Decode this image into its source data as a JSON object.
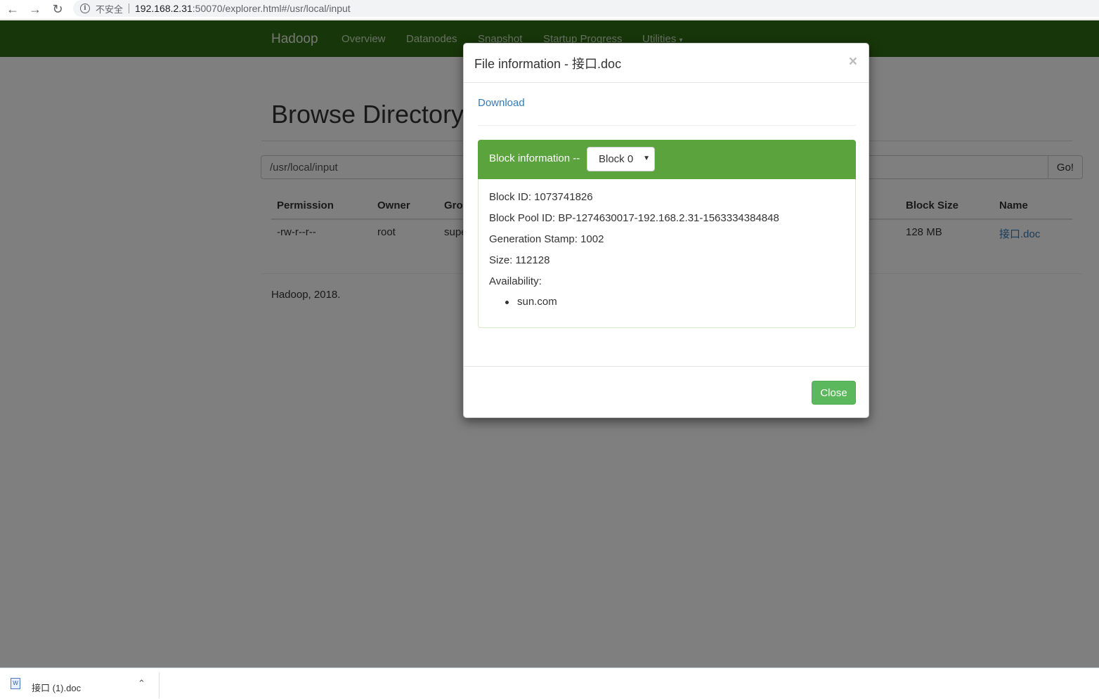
{
  "browser": {
    "insecure_label": "不安全",
    "url_host": "192.168.2.31",
    "url_rest": ":50070/explorer.html#/usr/local/input"
  },
  "navbar": {
    "brand": "Hadoop",
    "links": [
      "Overview",
      "Datanodes",
      "Snapshot",
      "Startup Progress",
      "Utilities"
    ]
  },
  "page": {
    "heading": "Browse Directory",
    "path_value": "/usr/local/input",
    "go_label": "Go!",
    "columns": [
      "Permission",
      "Owner",
      "Gro",
      "Block Size",
      "Name"
    ],
    "row": {
      "permission": "-rw-r--r--",
      "owner": "root",
      "group": "supe",
      "block_size": "128 MB",
      "name": "接口.doc"
    },
    "footer": "Hadoop, 2018."
  },
  "modal": {
    "title": "File information - 接口.doc",
    "close_x": "×",
    "download": "Download",
    "block_info_label": "Block information --",
    "block_selected": "Block 0",
    "block_id": "Block ID: 1073741826",
    "block_pool_id": "Block Pool ID: BP-1274630017-192.168.2.31-1563334384848",
    "generation_stamp": "Generation Stamp: 1002",
    "size": "Size: 112128",
    "availability_label": "Availability:",
    "availability_item": "sun.com",
    "close_label": "Close"
  },
  "download_bar": {
    "file_name": "接口 (1).doc"
  },
  "colors": {
    "navbar": "#2f6d12",
    "panel_heading": "#5ba33c",
    "close_button": "#5cb85c",
    "link": "#337ab7"
  }
}
